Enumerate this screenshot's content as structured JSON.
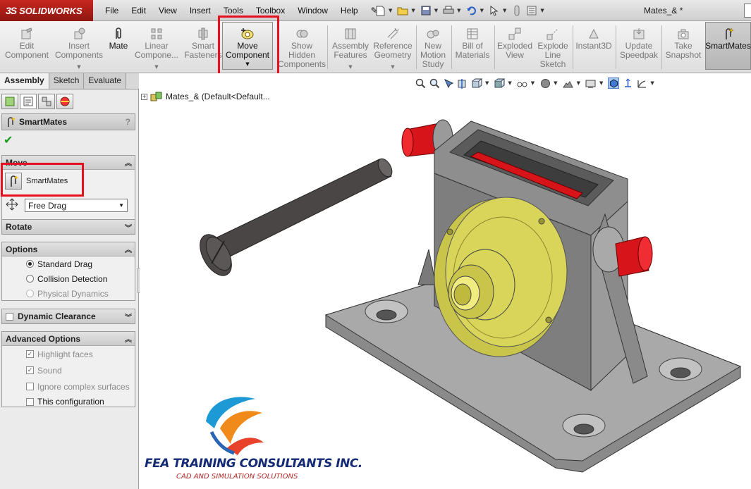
{
  "app": {
    "brand": "SOLIDWORKS",
    "brand_mark": "3S",
    "document_title": "Mates_& *"
  },
  "menu": [
    "File",
    "Edit",
    "View",
    "Insert",
    "Tools",
    "Toolbox",
    "Window",
    "Help"
  ],
  "quickbar_icons": [
    "new-icon",
    "open-icon",
    "save-icon",
    "print-icon",
    "undo-icon",
    "select-icon",
    "rebuild-icon",
    "options-icon"
  ],
  "ribbon": {
    "edit_component": "Edit\nComponent",
    "insert_components": "Insert\nComponents",
    "mate": "Mate",
    "linear_pattern": "Linear\nCompone...",
    "smart_fasteners": "Smart\nFasteners",
    "move_component": "Move\nComponent",
    "show_hidden": "Show\nHidden\nComponents",
    "assembly_features": "Assembly\nFeatures",
    "reference_geometry": "Reference\nGeometry",
    "new_motion_study": "New\nMotion\nStudy",
    "bill_of_materials": "Bill of\nMaterials",
    "exploded_view": "Exploded\nView",
    "explode_line_sketch": "Explode\nLine\nSketch",
    "instant3d": "Instant3D",
    "update_speedpak": "Update\nSpeedpak",
    "take_snapshot": "Take\nSnapshot",
    "smartmates": "SmartMates"
  },
  "tabs": [
    "Assembly",
    "Sketch",
    "Evaluate"
  ],
  "property_manager": {
    "title": "SmartMates",
    "help": "?",
    "move": {
      "header": "Move",
      "item": "SmartMates",
      "drag_mode": "Free Drag"
    },
    "rotate": {
      "header": "Rotate"
    },
    "options": {
      "header": "Options",
      "standard_drag": "Standard Drag",
      "collision_detection": "Collision Detection",
      "physical_dynamics": "Physical Dynamics",
      "selected": "Standard Drag"
    },
    "dynamic_clearance": {
      "header": "Dynamic Clearance",
      "checked": false
    },
    "advanced": {
      "header": "Advanced Options",
      "highlight_faces": "Highlight faces",
      "highlight_faces_checked": true,
      "sound": "Sound",
      "sound_checked": true,
      "ignore_complex": "Ignore complex surfaces",
      "ignore_complex_checked": false,
      "this_configuration": "This configuration",
      "this_configuration_checked": false
    }
  },
  "feature_tree": {
    "root": "Mates_&  (Default<Default..."
  },
  "watermark": {
    "company": "FEA TRAINING  CONSULTANTS INC.",
    "tagline": "CAD AND SIMULATION SOLUTIONS"
  },
  "colors": {
    "highlight": "#e8101f",
    "housing": "#8e8e8e",
    "flange": "#d9d55a",
    "shaft_red": "#d8141b"
  }
}
